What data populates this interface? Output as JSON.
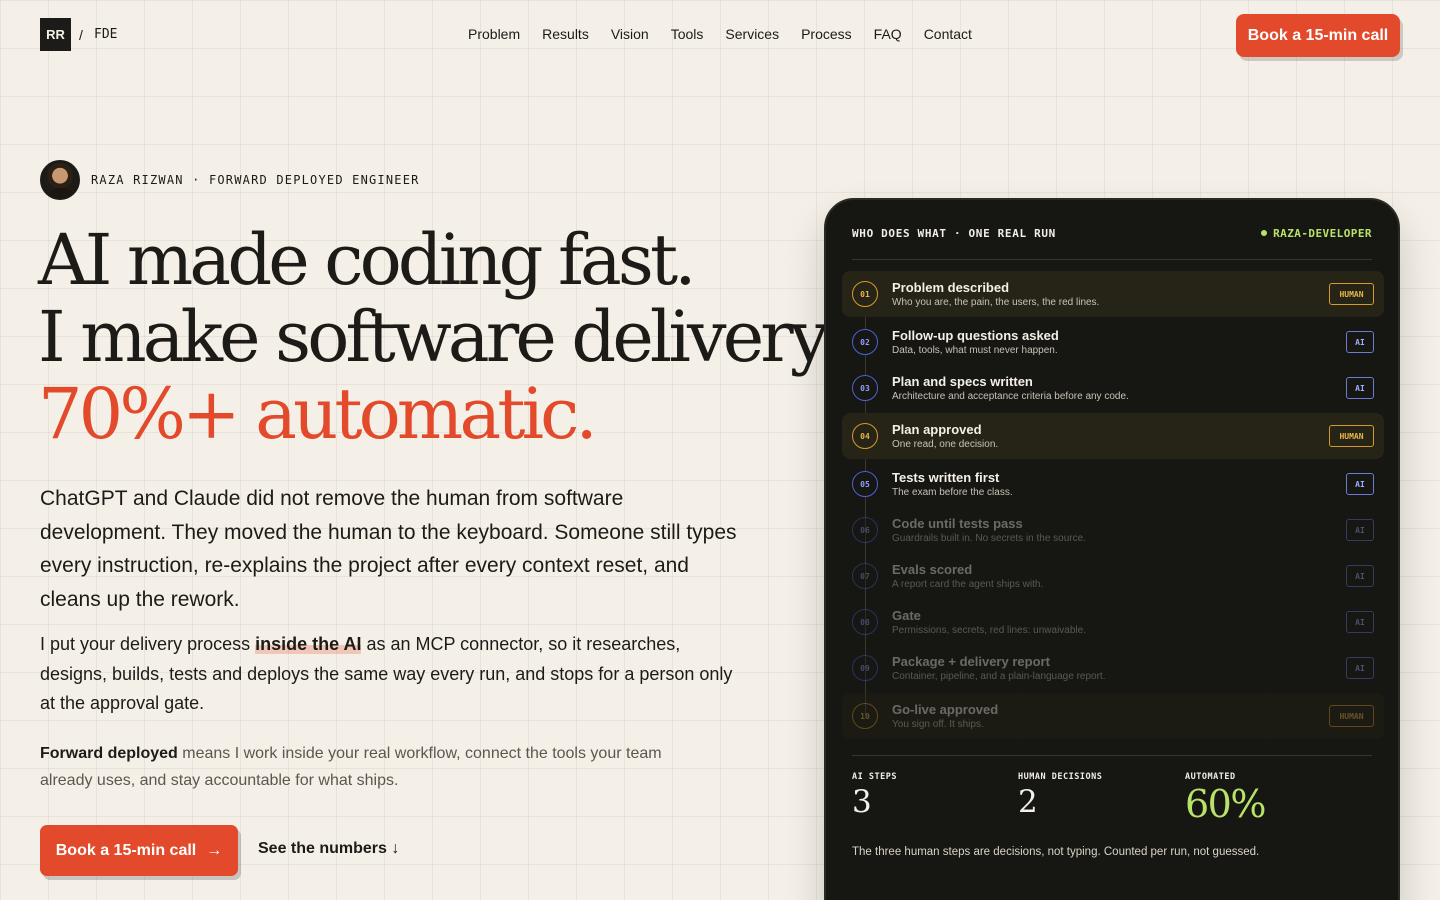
{
  "nav": {
    "logo": "RR",
    "slash": "/",
    "sub": "FDE",
    "links": [
      "Problem",
      "Results",
      "Vision",
      "Tools",
      "Services",
      "Process",
      "FAQ",
      "Contact"
    ],
    "cta": "Book a 15-min call"
  },
  "hero": {
    "byline": "RAZA RIZWAN · FORWARD DEPLOYED ENGINEER",
    "headline_1": "AI made coding fast.",
    "headline_2": "I make software delivery",
    "headline_3": "70%+ automatic.",
    "lead": "ChatGPT and Claude did not remove the human from software development. They moved the human to the keyboard. Someone still types every instruction, re-explains the project after every context reset, and cleans up the rework.",
    "para2_before": "I put your delivery process ",
    "para2_highlight": "inside the AI",
    "para2_after": " as an MCP connector, so it researches, designs, builds, tests and deploys the same way every run, and stops for a person only at the approval gate.",
    "para3_bold": "Forward deployed",
    "para3_rest": " means I work inside your real workflow, connect the tools your team already uses, and stay accountable for what ships.",
    "cta_primary": "Book a 15-min call",
    "cta_arrow": "→",
    "cta_secondary": "See the numbers ↓"
  },
  "card": {
    "title": "WHO DOES WHAT · ONE REAL RUN",
    "tag": "RAZA-DEVELOPER",
    "steps": [
      {
        "num": "01",
        "title": "Problem described",
        "desc": "Who you are, the pain, the users, the red lines.",
        "badge": "HUMAN"
      },
      {
        "num": "02",
        "title": "Follow-up questions asked",
        "desc": "Data, tools, what must never happen.",
        "badge": "AI"
      },
      {
        "num": "03",
        "title": "Plan and specs written",
        "desc": "Architecture and acceptance criteria before any code.",
        "badge": "AI"
      },
      {
        "num": "04",
        "title": "Plan approved",
        "desc": "One read, one decision.",
        "badge": "HUMAN"
      },
      {
        "num": "05",
        "title": "Tests written first",
        "desc": "The exam before the class.",
        "badge": "AI"
      },
      {
        "num": "06",
        "title": "Code until tests pass",
        "desc": "Guardrails built in. No secrets in the source.",
        "badge": "AI"
      },
      {
        "num": "07",
        "title": "Evals scored",
        "desc": "A report card the agent ships with.",
        "badge": "AI"
      },
      {
        "num": "08",
        "title": "Gate",
        "desc": "Permissions, secrets, red lines: unwaivable.",
        "badge": "AI"
      },
      {
        "num": "09",
        "title": "Package + delivery report",
        "desc": "Container, pipeline, and a plain-language report.",
        "badge": "AI"
      },
      {
        "num": "10",
        "title": "Go-live approved",
        "desc": "You sign off. It ships.",
        "badge": "HUMAN"
      }
    ],
    "stats": {
      "ai_label": "AI STEPS",
      "ai_value": "3",
      "human_label": "HUMAN DECISIONS",
      "human_value": "2",
      "auto_label": "AUTOMATED",
      "auto_value": "60%"
    },
    "foot": "The three human steps are decisions, not typing. Counted per run, not guessed."
  }
}
